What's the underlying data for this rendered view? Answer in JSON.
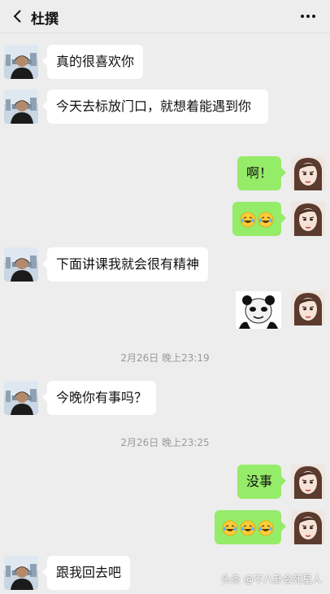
{
  "header": {
    "title": "杜撰",
    "back_icon": "chevron-left-icon",
    "more_icon": "more-dots-icon"
  },
  "messages": [
    {
      "side": "left",
      "text": "真的很喜欢你"
    },
    {
      "side": "left",
      "text": "今天去标放门口，就想着能遇到你"
    },
    {
      "side": "right",
      "text": "啊！"
    },
    {
      "side": "right",
      "emoji_count": 2,
      "emoji": "crying-laughing-emoji"
    },
    {
      "side": "left",
      "text": "下面讲课我就会很有精神"
    },
    {
      "side": "right",
      "sticker": "panda-meme-sticker"
    },
    {
      "timestamp": "2月26日 晚上23:19"
    },
    {
      "side": "left",
      "text": "今晚你有事吗？"
    },
    {
      "timestamp": "2月26日 晚上23:25"
    },
    {
      "side": "right",
      "text": "没事"
    },
    {
      "side": "right",
      "emoji_count": 3,
      "emoji": "crying-laughing-emoji"
    },
    {
      "side": "left",
      "text": "跟我回去吧"
    }
  ],
  "labels": {
    "msg1": "真的很喜欢你",
    "msg2": "今天去标放门口，就想着能遇到你",
    "msg3": "啊！",
    "msg5": "下面讲课我就会很有精神",
    "ts1": "2月26日 晚上23:19",
    "msg7": "今晚你有事吗？",
    "ts2": "2月26日 晚上23:25",
    "msg8": "没事",
    "msg10": "跟我回去吧",
    "watermark": "头条 @不八卦会死星人"
  },
  "colors": {
    "background": "#ededed",
    "bubble_left": "#ffffff",
    "bubble_right": "#95ec69"
  }
}
